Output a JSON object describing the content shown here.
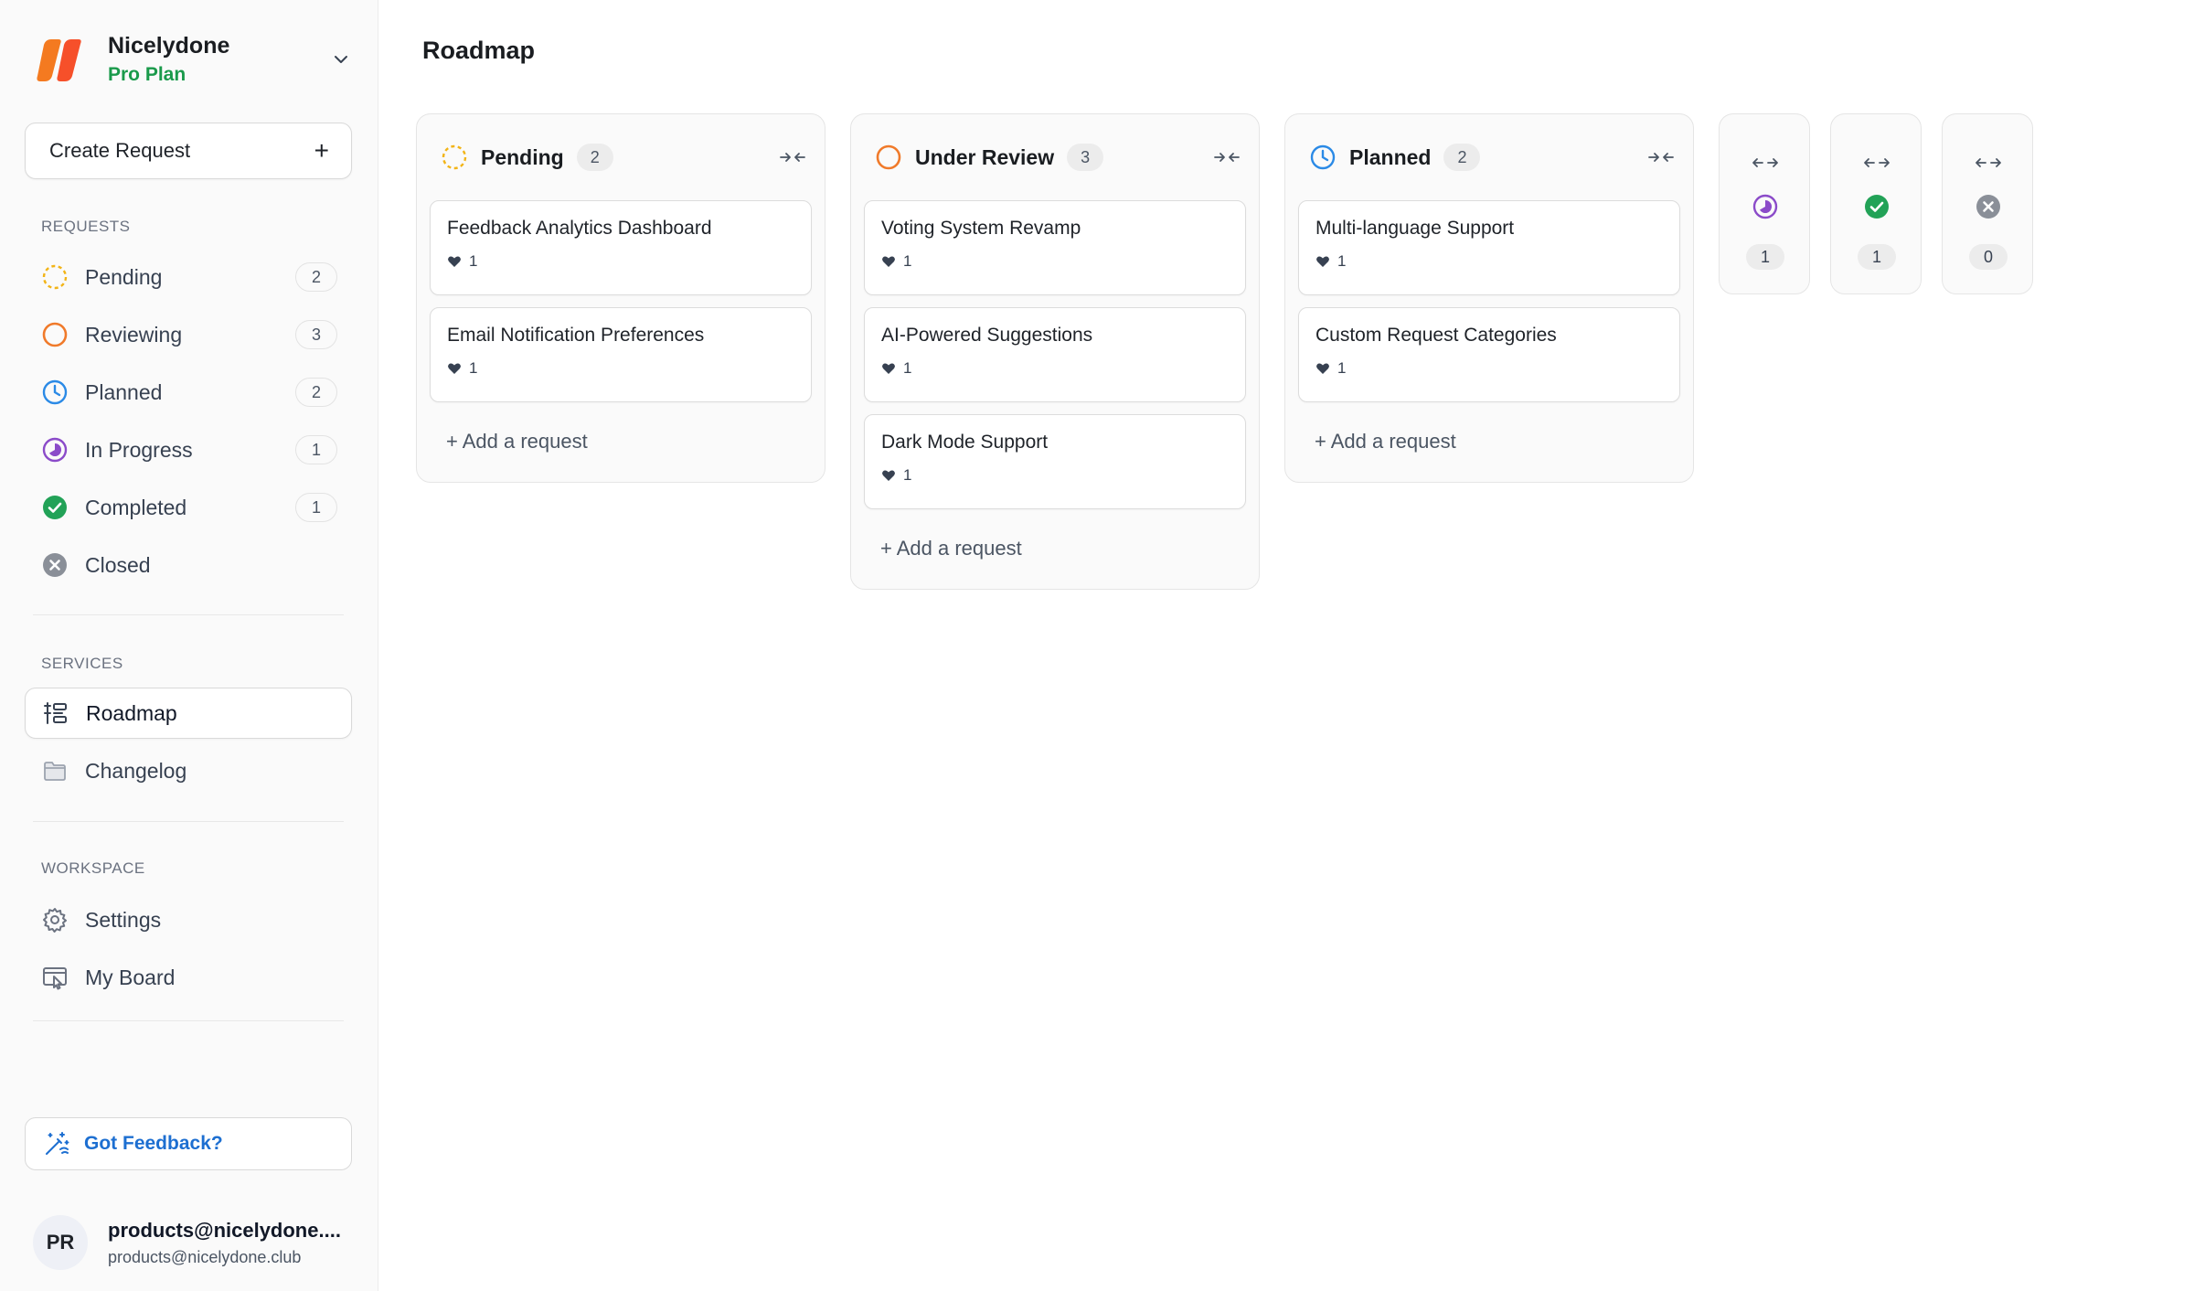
{
  "workspace": {
    "name": "Nicelydone",
    "plan": "Pro Plan"
  },
  "sidebar": {
    "create_label": "Create Request",
    "requests_title": "REQUESTS",
    "requests": [
      {
        "label": "Pending",
        "count": "2"
      },
      {
        "label": "Reviewing",
        "count": "3"
      },
      {
        "label": "Planned",
        "count": "2"
      },
      {
        "label": "In Progress",
        "count": "1"
      },
      {
        "label": "Completed",
        "count": "1"
      },
      {
        "label": "Closed"
      }
    ],
    "services_title": "SERVICES",
    "services": [
      {
        "label": "Roadmap"
      },
      {
        "label": "Changelog"
      }
    ],
    "workspace_title": "WORKSPACE",
    "workspace_items": [
      {
        "label": "Settings"
      },
      {
        "label": "My Board"
      }
    ],
    "feedback_label": "Got Feedback?"
  },
  "user": {
    "initials": "PR",
    "name": "products@nicelydone....",
    "email": "products@nicelydone.club"
  },
  "main": {
    "title": "Roadmap",
    "add_request_label": "+ Add a request",
    "columns": [
      {
        "title": "Pending",
        "count": "2",
        "cards": [
          {
            "title": "Feedback Analytics Dashboard",
            "votes": "1"
          },
          {
            "title": "Email Notification Preferences",
            "votes": "1"
          }
        ]
      },
      {
        "title": "Under Review",
        "count": "3",
        "cards": [
          {
            "title": "Voting System Revamp",
            "votes": "1"
          },
          {
            "title": "AI-Powered Suggestions",
            "votes": "1"
          },
          {
            "title": "Dark Mode Support",
            "votes": "1"
          }
        ]
      },
      {
        "title": "Planned",
        "count": "2",
        "cards": [
          {
            "title": "Multi-language Support",
            "votes": "1"
          },
          {
            "title": "Custom Request Categories",
            "votes": "1"
          }
        ]
      }
    ],
    "collapsed_columns": [
      {
        "status": "in-progress",
        "count": "1"
      },
      {
        "status": "completed",
        "count": "1"
      },
      {
        "status": "closed",
        "count": "0"
      }
    ]
  },
  "colors": {
    "pending": "#f2b417",
    "reviewing": "#f07a2a",
    "planned": "#2b8ae6",
    "in_progress": "#8b4bc9",
    "completed": "#22a257",
    "closed": "#8a8f98",
    "brand": "#f47a20",
    "plan_green": "#1a9a4b",
    "feedback_blue": "#1d6fd1"
  }
}
